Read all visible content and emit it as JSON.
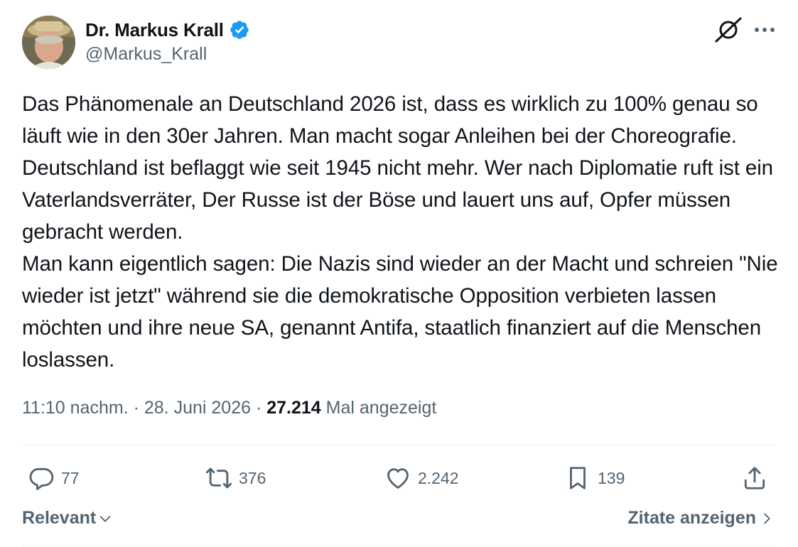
{
  "author": {
    "display_name": "Dr. Markus Krall",
    "handle": "@Markus_Krall",
    "verified_icon": "verified-badge-icon",
    "verified_color": "#1d9bf0"
  },
  "tweet": {
    "text": "Das Phänomenale an Deutschland 2026 ist, dass es wirklich zu 100% genau so läuft wie in den 30er Jahren. Man macht sogar Anleihen bei der Choreografie. Deutschland ist beflaggt wie seit 1945 nicht mehr. Wer nach Diplomatie ruft ist ein Vaterlandsverräter, Der Russe ist der Böse und lauert uns auf, Opfer müssen gebracht werden.\nMan kann eigentlich sagen: Die Nazis sind wieder an der Macht und schreien \"Nie wieder ist jetzt\" während sie die demokratische Opposition verbieten lassen möchten und ihre neue SA, genannt Antifa, staatlich finanziert auf die Menschen loslassen.",
    "time": "11:10 nachm.",
    "separator": "·",
    "date": "28. Juni 2026",
    "views": "27.214",
    "views_label": "Mal angezeigt"
  },
  "actions": {
    "replies": "77",
    "reposts": "376",
    "likes": "2.242",
    "bookmarks": "139"
  },
  "footer": {
    "sort_label": "Relevant",
    "quotes_label": "Zitate anzeigen"
  },
  "colors": {
    "text": "#0f1419",
    "secondary": "#536471",
    "divider": "#eff3f4"
  }
}
